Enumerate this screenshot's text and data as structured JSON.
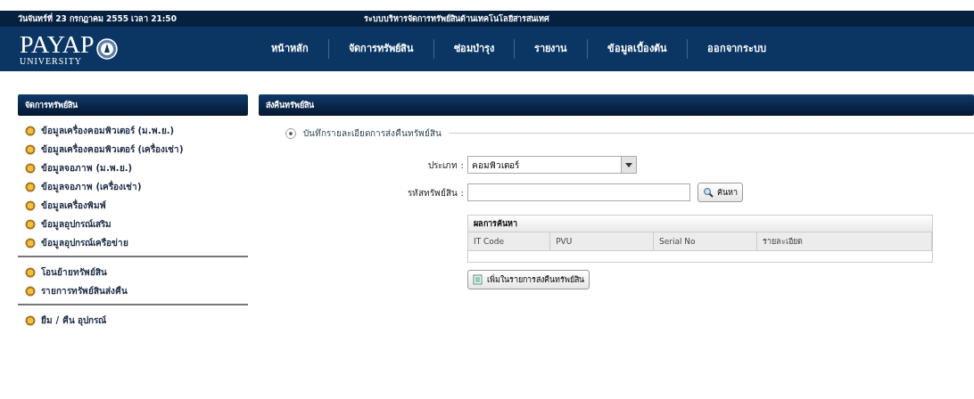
{
  "header": {
    "date": "วันจันทร์ที่ 23 กรกฎาคม 2555 เวลา 21:50",
    "system_title": "ระบบบริหารจัดการทรัพย์สินด้านเทคโนโลยีสารสนเทศ",
    "logo": {
      "name": "PAYAP",
      "sub": "UNIVERSITY"
    }
  },
  "nav": [
    {
      "label": "หน้าหลัก"
    },
    {
      "label": "จัดการทรัพย์สิน"
    },
    {
      "label": "ซ่อมบำรุง"
    },
    {
      "label": "รายงาน"
    },
    {
      "label": "ข้อมูลเบื้องต้น"
    },
    {
      "label": "ออกจากระบบ"
    }
  ],
  "sidebar": {
    "title": "จัดการทรัพย์สิน",
    "groups": [
      [
        "ข้อมูลเครื่องคอมพิวเตอร์ (ม.พ.ย.)",
        "ข้อมูลเครื่องคอมพิวเตอร์ (เครื่องเช่า)",
        "ข้อมูลจอภาพ (ม.พ.ย.)",
        "ข้อมูลจอภาพ (เครื่องเช่า)",
        "ข้อมูลเครื่องพิมพ์",
        "ข้อมูลอุปกรณ์เสริม",
        "ข้อมูลอุปกรณ์เครือข่าย"
      ],
      [
        "โอนย้ายทรัพย์สิน",
        "รายการทรัพย์สินส่งคืน"
      ],
      [
        "ยืม / คืน อุปกรณ์"
      ]
    ]
  },
  "main": {
    "title": "ส่งคืนทรัพย์สิน",
    "section": {
      "legend": "บันทึกรายละเอียดการส่งคืนทรัพย์สิน",
      "expanded": true
    },
    "type_label": "ประเภท :",
    "type_value": "คอมพิวเตอร์",
    "code_label": "รหัสทรัพย์สิน :",
    "search_button": "ค้นหา",
    "results": {
      "title": "ผลการค้นหา",
      "columns": [
        "IT Code",
        "PVU",
        "Serial No",
        "รายละเอียด"
      ]
    },
    "add_button": "เพิ่มในรายการส่งคืนทรัพย์สิน"
  }
}
